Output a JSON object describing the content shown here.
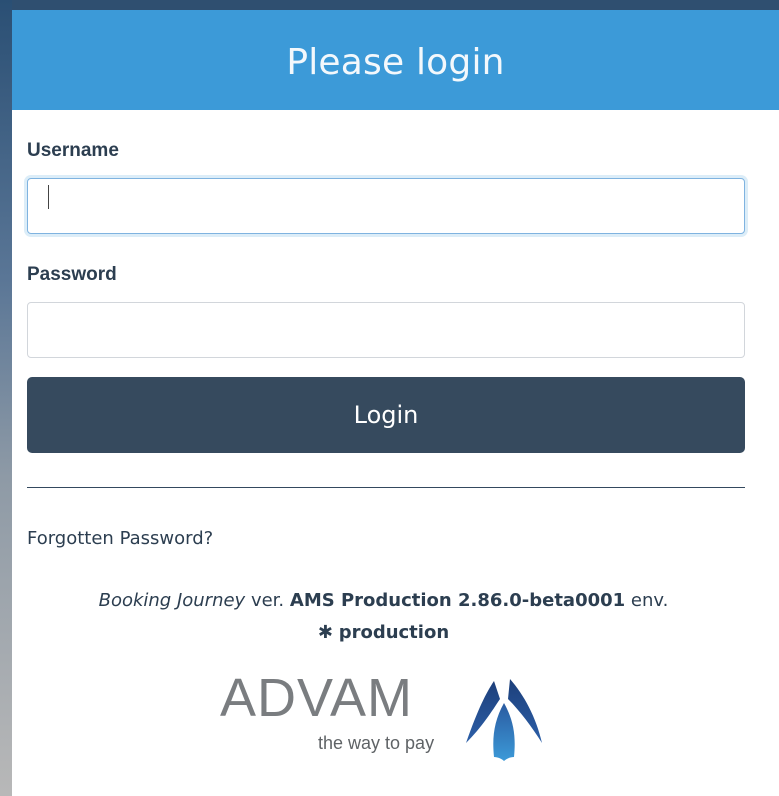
{
  "header": {
    "title": "Please login"
  },
  "form": {
    "username_label": "Username",
    "username_value": "",
    "password_label": "Password",
    "password_value": "",
    "login_label": "Login"
  },
  "links": {
    "forgot_password": "Forgotten Password?"
  },
  "version": {
    "app_name": "Booking Journey",
    "ver_label": "ver.",
    "version_string": "AMS Production 2.86.0-beta0001",
    "env_label": "env.",
    "env_icon": "asterisk-icon",
    "environment": "production"
  },
  "logo": {
    "wordmark": "ADVAM",
    "tagline": "the way to pay",
    "colors": {
      "wordmark": "#7a7d80",
      "mark_dark": "#1d3f7a",
      "mark_light": "#3c9ad8"
    }
  },
  "colors": {
    "header_bg": "#3c9ad8",
    "button_bg": "#364a5e",
    "text": "#2c3e50"
  }
}
